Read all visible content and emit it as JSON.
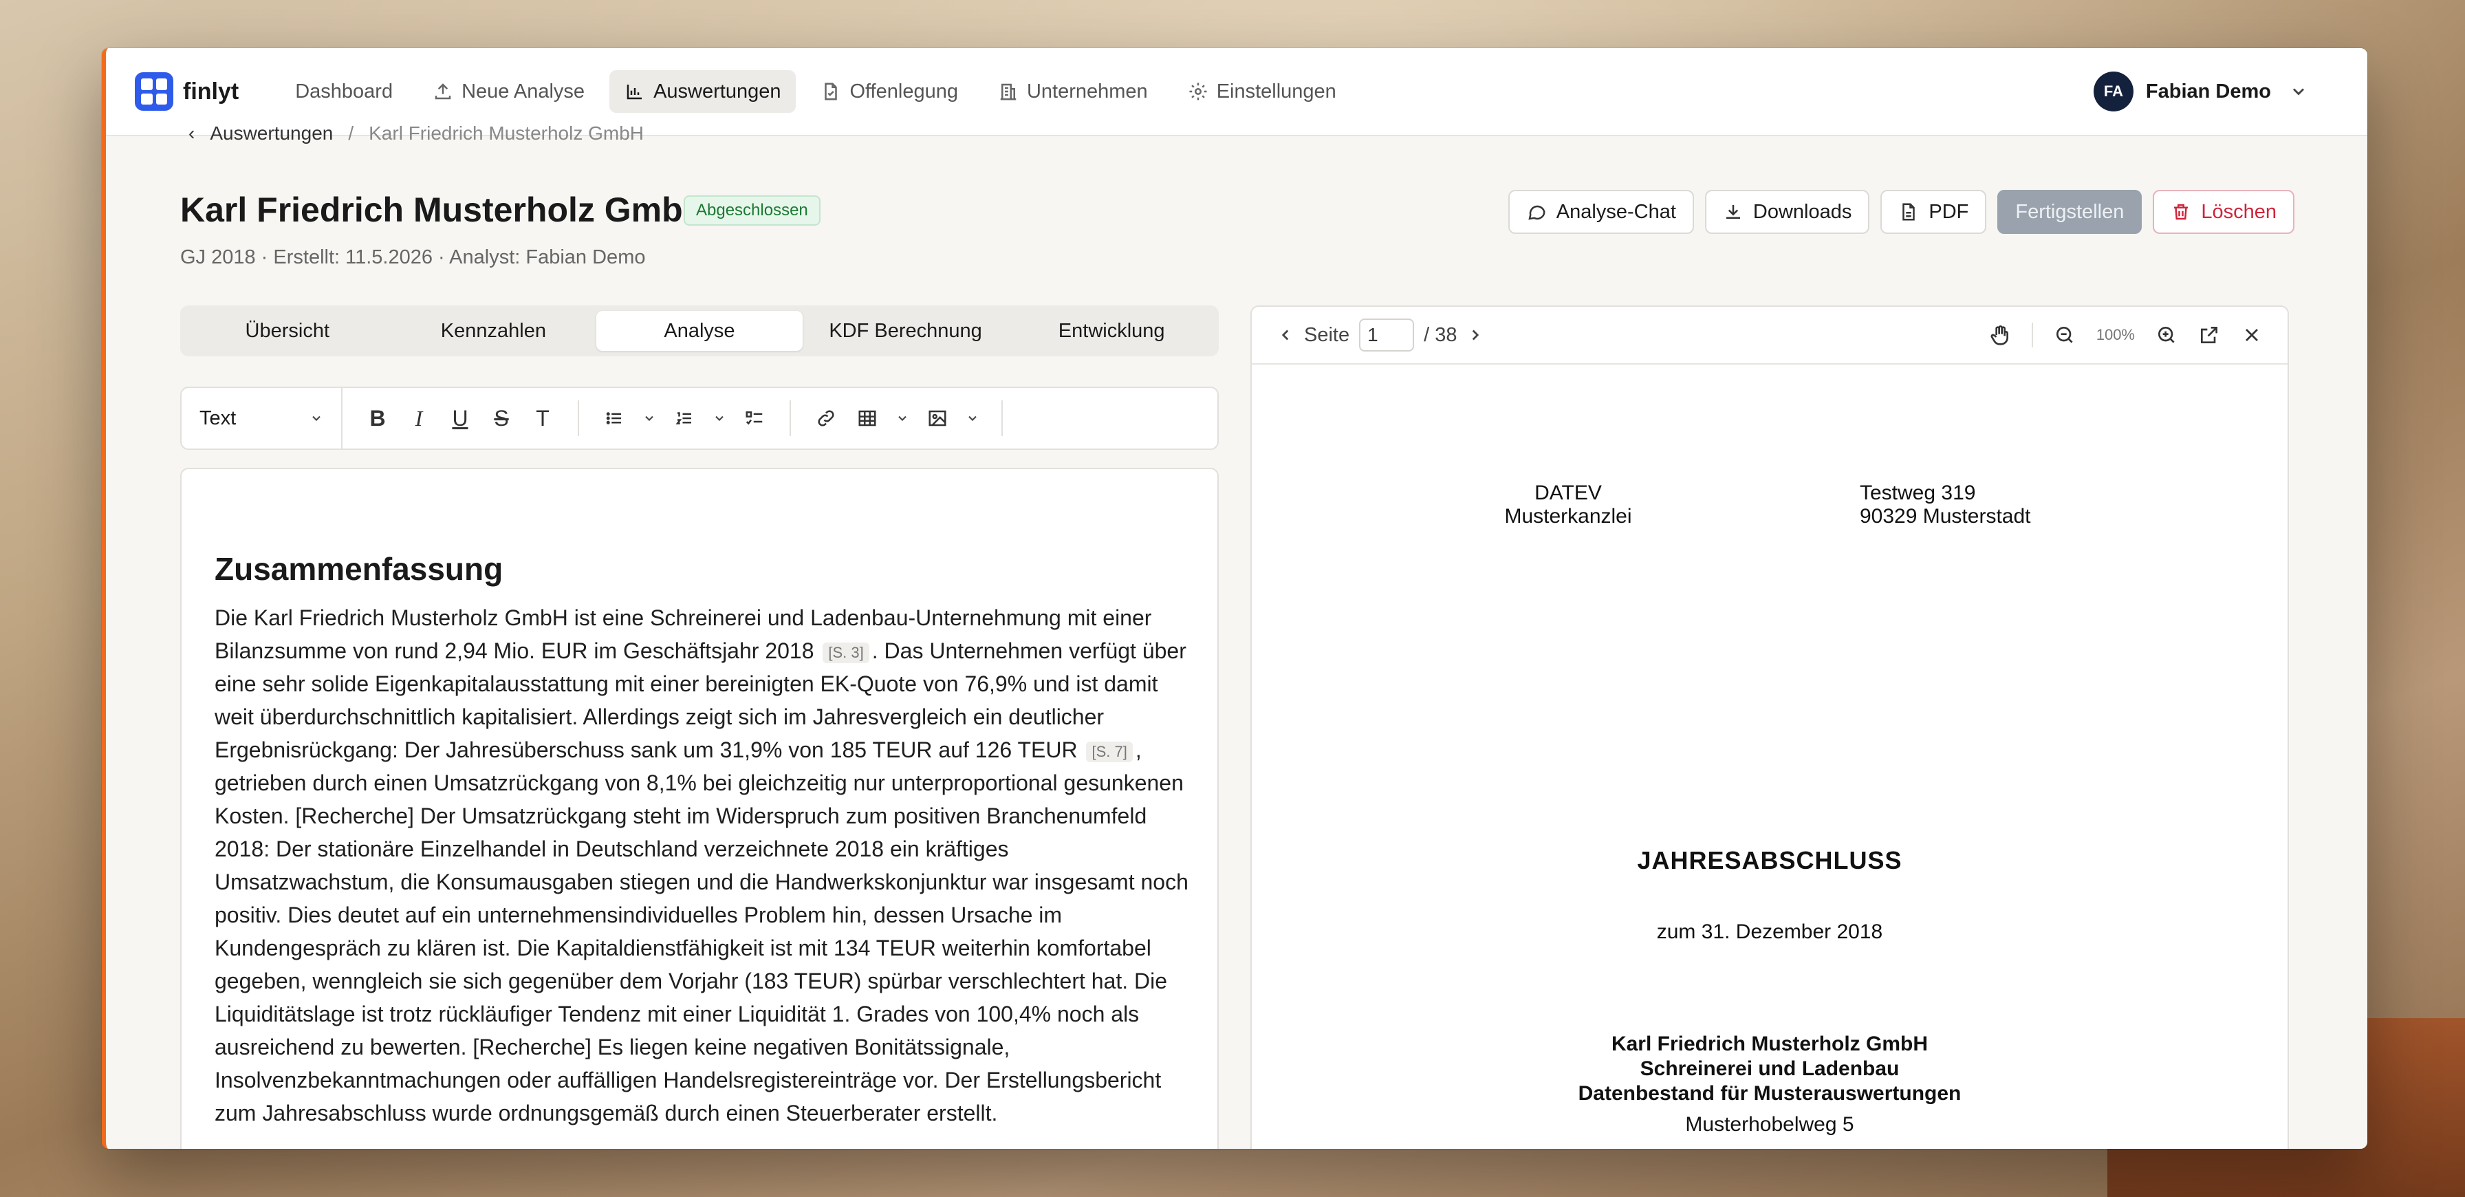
{
  "app": {
    "name": "finlyt"
  },
  "nav": {
    "items": [
      {
        "label": "Dashboard",
        "icon": "none"
      },
      {
        "label": "Neue Analyse",
        "icon": "upload-icon"
      },
      {
        "label": "Auswertungen",
        "icon": "bar-chart-icon",
        "active": true
      },
      {
        "label": "Offenlegung",
        "icon": "file-icon"
      },
      {
        "label": "Unternehmen",
        "icon": "building-icon"
      },
      {
        "label": "Einstellungen",
        "icon": "gear-icon"
      }
    ]
  },
  "user": {
    "initials": "FA",
    "name": "Fabian Demo"
  },
  "breadcrumb": {
    "parent": "Auswertungen",
    "current": "Karl Friedrich Musterholz GmbH"
  },
  "header": {
    "title": "Karl Friedrich Musterholz GmbH",
    "status": "Abgeschlossen",
    "meta": "GJ 2018 · Erstellt: 11.5.2026 · Analyst: Fabian Demo"
  },
  "actions": {
    "chat": "Analyse-Chat",
    "downloads": "Downloads",
    "pdf": "PDF",
    "finish": "Fertigstellen",
    "delete": "Löschen"
  },
  "tabs": [
    {
      "label": "Übersicht"
    },
    {
      "label": "Kennzahlen"
    },
    {
      "label": "Analyse",
      "active": true
    },
    {
      "label": "KDF Berechnung"
    },
    {
      "label": "Entwicklung"
    }
  ],
  "toolbar": {
    "block_type": "Text"
  },
  "editor": {
    "heading": "Zusammenfassung",
    "p1": "Die Karl Friedrich Musterholz GmbH ist eine Schreinerei und Ladenbau-Unternehmung mit einer Bilanzsumme von rund 2,94 Mio. EUR im Geschäftsjahr 2018",
    "ref1": "[S. 3]",
    "p2": ". Das Unternehmen verfügt über eine sehr solide Eigenkapitalausstattung mit einer bereinigten EK-Quote von 76,9% und ist damit weit überdurchschnittlich kapitalisiert. Allerdings zeigt sich im Jahresvergleich ein deutlicher Ergebnisrückgang: Der Jahresüberschuss sank um 31,9% von 185 TEUR auf 126 TEUR",
    "ref2": "[S. 7]",
    "p3": ", getrieben durch einen Umsatzrückgang von 8,1% bei gleichzeitig nur unterproportional gesunkenen Kosten. [Recherche] Der Umsatzrückgang steht im Widerspruch zum positiven Branchenumfeld 2018: Der stationäre Einzelhandel in Deutschland verzeichnete 2018 ein kräftiges Umsatzwachstum, die Konsumausgaben stiegen und die Handwerkskonjunktur war insgesamt noch positiv. Dies deutet auf ein unternehmensindividuelles Problem hin, dessen Ursache im Kundengespräch zu klären ist. Die Kapitaldienstfähigkeit ist mit 134 TEUR weiterhin komfortabel gegeben, wenngleich sie sich gegenüber dem Vorjahr (183 TEUR) spürbar verschlechtert hat. Die Liquiditätslage ist trotz rückläufiger Tendenz mit einer Liquidität 1. Grades von 100,4% noch als ausreichend zu bewerten. [Recherche] Es liegen keine negativen Bonitätssignale, Insolvenzbekanntmachungen oder auffälligen Handelsregistereinträge vor. Der Erstellungsbericht zum Jahresabschluss wurde ordnungsgemäß durch einen Steuerberater erstellt."
  },
  "viewer": {
    "page_label": "Seite",
    "page_value": "1",
    "page_total": "/ 38",
    "zoom": "100%"
  },
  "document": {
    "left_block_1": "DATEV",
    "left_block_2": "Musterkanzlei",
    "right_block_1": "Testweg 319",
    "right_block_2": "90329 Musterstadt",
    "title": "JAHRESABSCHLUSS",
    "date": "zum 31. Dezember 2018",
    "company_1": "Karl Friedrich Musterholz GmbH",
    "company_2": "Schreinerei und Ladenbau",
    "company_3": "Datenbestand für Musterauswertungen",
    "street": "Musterhobelweg 5"
  },
  "colors": {
    "brand": "#2f5bea",
    "accent_bar": "#f26b1d",
    "success": "#1c7a35",
    "danger": "#d1243a"
  }
}
